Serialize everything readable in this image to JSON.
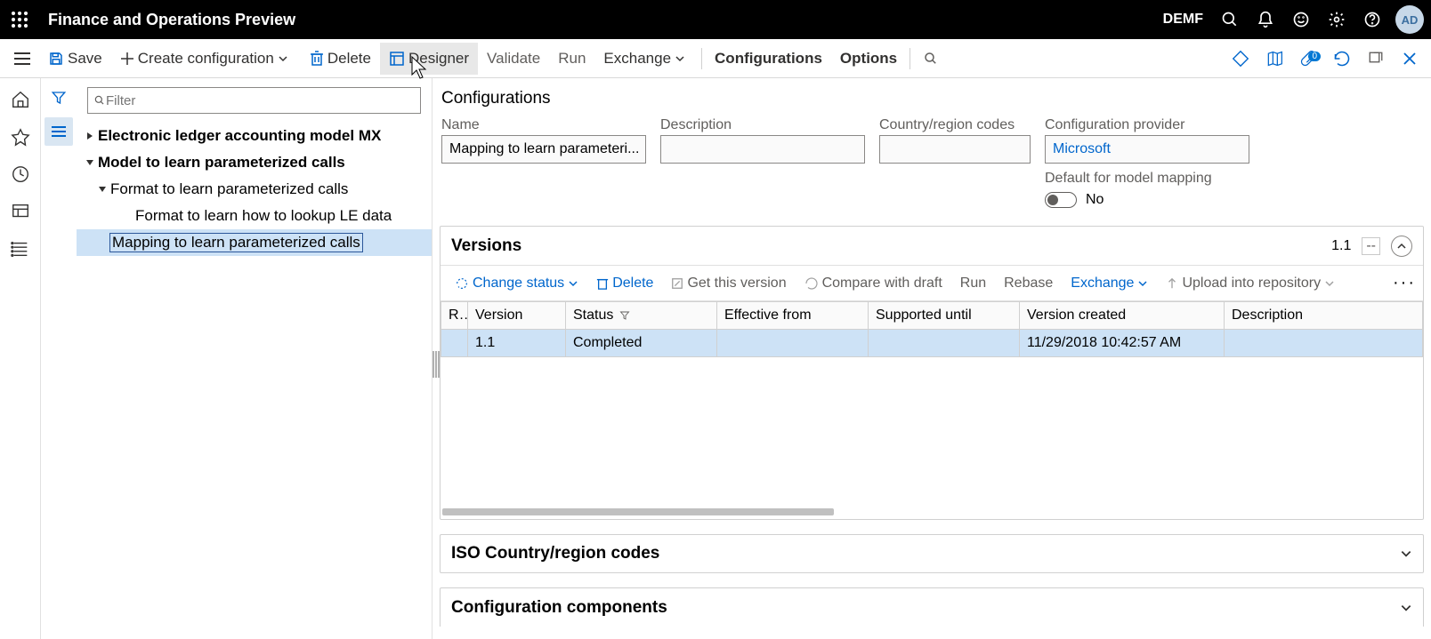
{
  "topbar": {
    "title": "Finance and Operations Preview",
    "company": "DEMF",
    "avatar": "AD"
  },
  "cmdbar": {
    "save": "Save",
    "create_config": "Create configuration",
    "delete": "Delete",
    "designer": "Designer",
    "validate": "Validate",
    "run": "Run",
    "exchange": "Exchange",
    "configurations": "Configurations",
    "options": "Options",
    "badge": "0"
  },
  "filter": {
    "placeholder": "Filter"
  },
  "tree": {
    "n0": "Electronic ledger accounting model MX",
    "n1": "Model to learn parameterized calls",
    "n2": "Format to learn parameterized calls",
    "n3": "Format to learn how to lookup LE data",
    "n4": "Mapping to learn parameterized calls"
  },
  "page": {
    "title": "Configurations"
  },
  "form": {
    "name_label": "Name",
    "name_value": "Mapping to learn parameteri...",
    "desc_label": "Description",
    "desc_value": "",
    "country_label": "Country/region codes",
    "country_value": "",
    "provider_label": "Configuration provider",
    "provider_value": "Microsoft",
    "default_label": "Default for model mapping",
    "toggle_text": "No"
  },
  "versions": {
    "title": "Versions",
    "summary_num": "1.1",
    "summary_dash": "--",
    "toolbar": {
      "change_status": "Change status",
      "delete": "Delete",
      "get_version": "Get this version",
      "compare": "Compare with draft",
      "run": "Run",
      "rebase": "Rebase",
      "exchange": "Exchange",
      "upload": "Upload into repository"
    },
    "columns": {
      "r": "R...",
      "version": "Version",
      "status": "Status",
      "effective": "Effective from",
      "supported": "Supported until",
      "created": "Version created",
      "description": "Description"
    },
    "row": {
      "version": "1.1",
      "status": "Completed",
      "effective": "",
      "supported": "",
      "created": "11/29/2018 10:42:57 AM",
      "description": ""
    }
  },
  "sections": {
    "iso": "ISO Country/region codes",
    "components": "Configuration components"
  }
}
